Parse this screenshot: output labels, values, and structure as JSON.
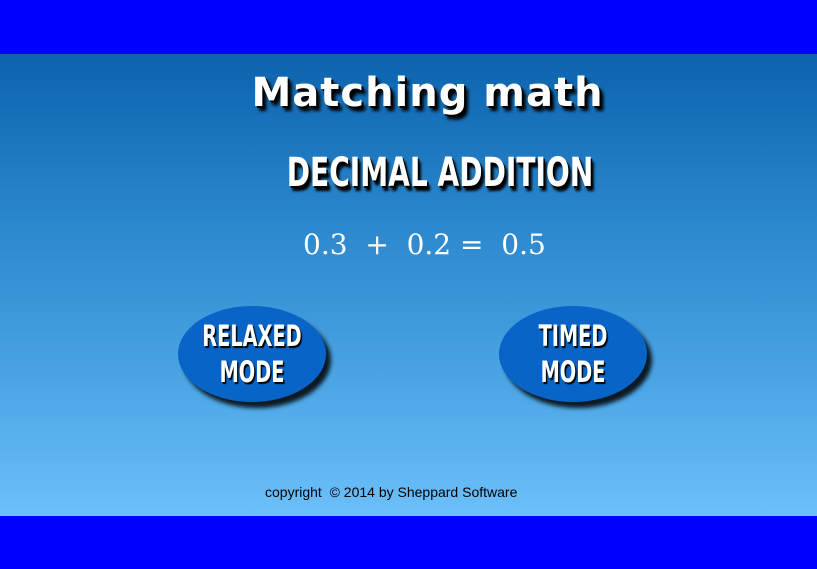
{
  "game": {
    "title": "Matching math",
    "subtitle": "DECIMAL ADDITION",
    "example_equation": "0.3  +  0.2 =  0.5",
    "buttons": {
      "relaxed": "RELAXED\nMODE",
      "timed": "TIMED\nMODE"
    },
    "copyright": "copyright  © 2014 by Sheppard Software"
  },
  "colors": {
    "frame_bar": "#0000ff",
    "gradient_top": "#0b63ad",
    "gradient_bottom": "#6cc0fb",
    "button_fill": "#0864c6",
    "text": "#ffffff"
  }
}
